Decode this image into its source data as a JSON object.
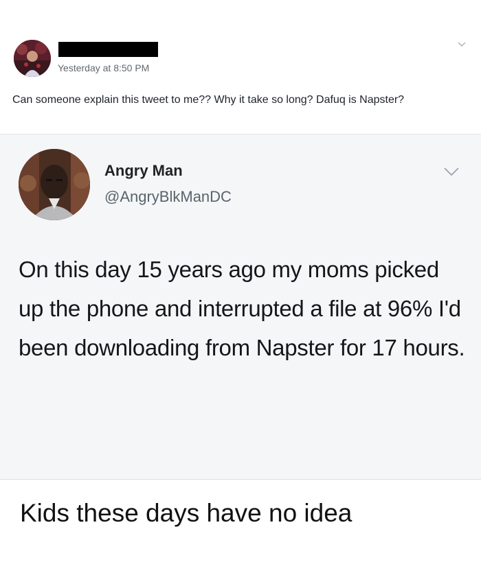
{
  "post": {
    "timestamp": "Yesterday at 8:50 PM",
    "caption": "Can someone explain this tweet to me?? Why it take so long? Dafuq is Napster?",
    "avatar_icon": "profile-photo",
    "menu_icon": "chevron-down-icon"
  },
  "tweet": {
    "name": "Angry Man",
    "handle": "@AngryBlkManDC",
    "text": "On this day 15 years ago my moms picked up the phone and interrupted a file at 96% I'd been downloading from Napster for 17 hours.",
    "avatar_icon": "profile-photo",
    "menu_icon": "chevron-down-icon"
  },
  "comment": {
    "text": "Kids these days have no idea"
  },
  "colors": {
    "tweet_background": "#f5f6f7",
    "handle_gray": "#58646e",
    "timestamp_gray": "#616770"
  }
}
